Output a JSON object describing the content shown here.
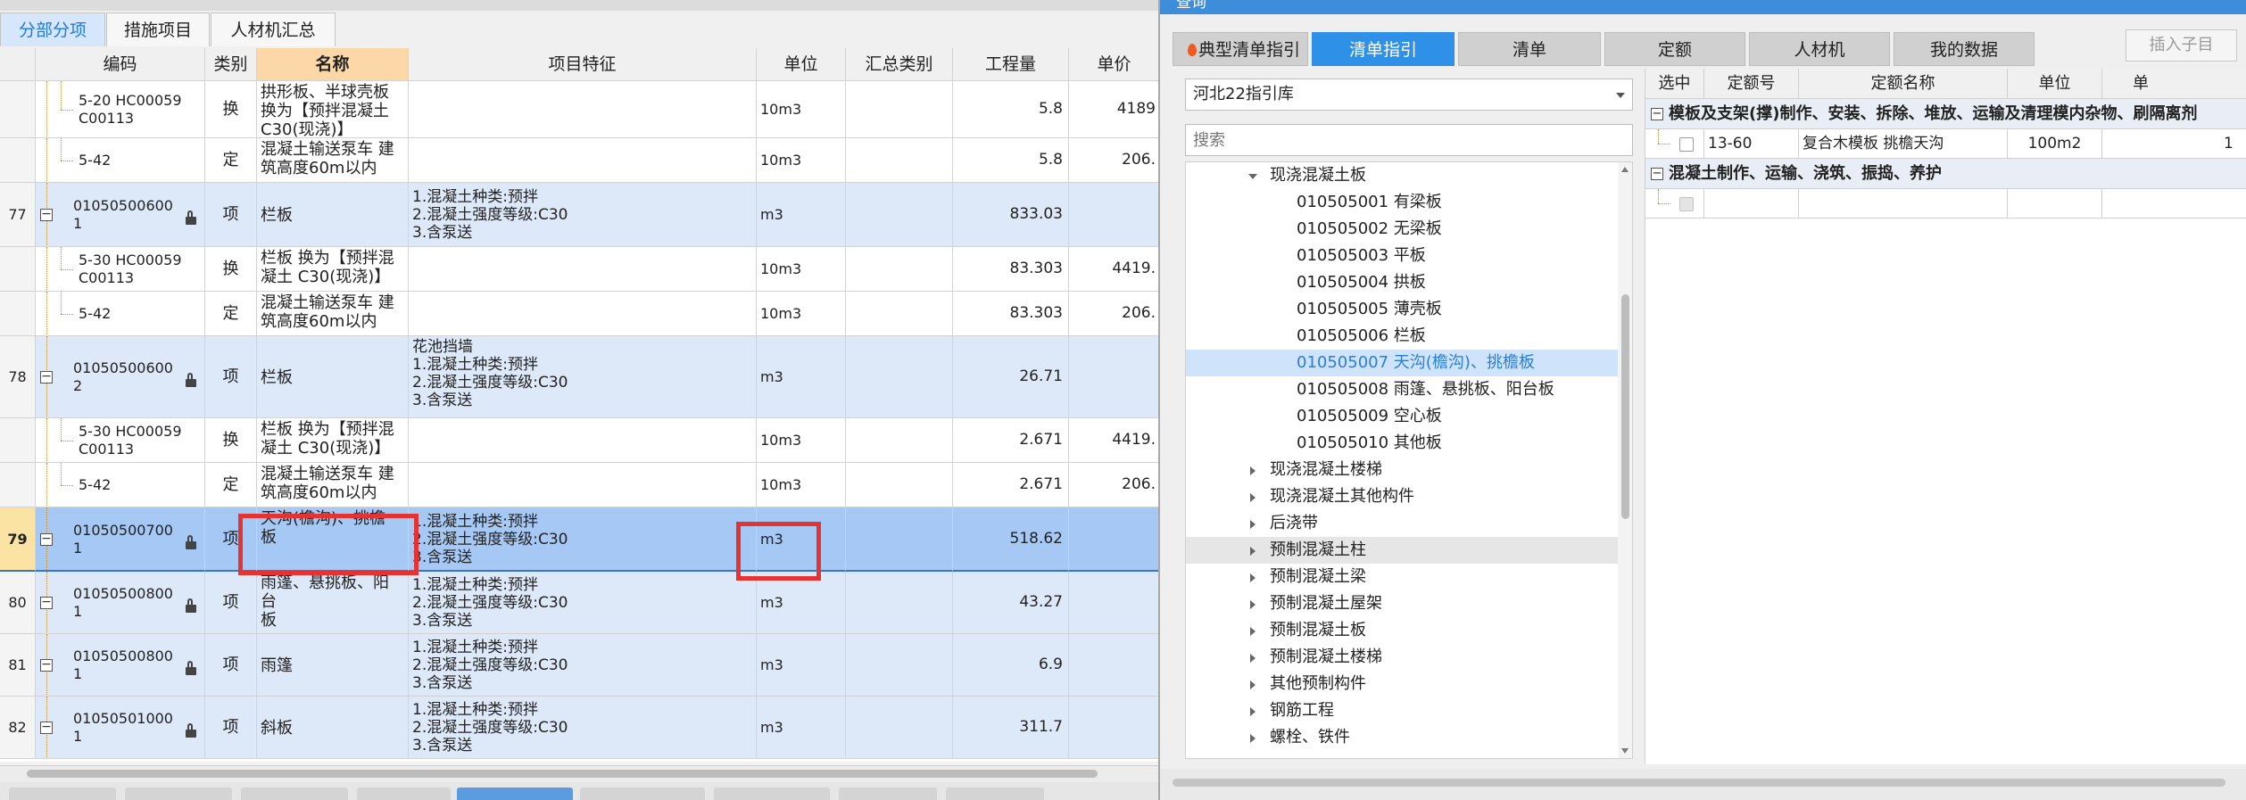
{
  "left_tabs": [
    "分部分项",
    "措施项目",
    "人材机汇总"
  ],
  "columns": {
    "code": "编码",
    "type": "类别",
    "name": "名称",
    "features": "项目特征",
    "unit": "单位",
    "summary_type": "汇总类别",
    "quantity": "工程量",
    "price": "单价"
  },
  "rows": [
    {
      "idx": "",
      "code1": "5-20 HC00059",
      "code2": "C00113",
      "type": "换",
      "name": [
        "拱形板、半球壳板",
        "换为【预拌混凝土",
        "C30(现浇)】"
      ],
      "features": [],
      "unit": "10m3",
      "qty": "5.8",
      "price": "4189"
    },
    {
      "idx": "",
      "code1": "5-42",
      "code2": "",
      "type": "定",
      "name": [
        "混凝土输送泵车 建",
        "筑高度60m以内"
      ],
      "features": [],
      "unit": "10m3",
      "qty": "5.8",
      "price": "206."
    },
    {
      "idx": "77",
      "code1": "01050500600",
      "code2": "1",
      "type": "项",
      "name": [
        "栏板"
      ],
      "features": [
        "1.混凝土种类:预拌",
        "2.混凝土强度等级:C30",
        "3.含泵送"
      ],
      "unit": "m3",
      "qty": "833.03",
      "price": ""
    },
    {
      "idx": "",
      "code1": "5-30 HC00059",
      "code2": "C00113",
      "type": "换",
      "name": [
        "栏板  换为【预拌混",
        "凝土 C30(现浇)】"
      ],
      "features": [],
      "unit": "10m3",
      "qty": "83.303",
      "price": "4419."
    },
    {
      "idx": "",
      "code1": "5-42",
      "code2": "",
      "type": "定",
      "name": [
        "混凝土输送泵车 建",
        "筑高度60m以内"
      ],
      "features": [],
      "unit": "10m3",
      "qty": "83.303",
      "price": "206."
    },
    {
      "idx": "78",
      "code1": "01050500600",
      "code2": "2",
      "type": "项",
      "name": [
        "栏板"
      ],
      "features": [
        "花池挡墙",
        "1.混凝土种类:预拌",
        "2.混凝土强度等级:C30",
        "3.含泵送"
      ],
      "unit": "m3",
      "qty": "26.71",
      "price": ""
    },
    {
      "idx": "",
      "code1": "5-30 HC00059",
      "code2": "C00113",
      "type": "换",
      "name": [
        "栏板  换为【预拌混",
        "凝土 C30(现浇)】"
      ],
      "features": [],
      "unit": "10m3",
      "qty": "2.671",
      "price": "4419."
    },
    {
      "idx": "",
      "code1": "5-42",
      "code2": "",
      "type": "定",
      "name": [
        "混凝土输送泵车 建",
        "筑高度60m以内"
      ],
      "features": [],
      "unit": "10m3",
      "qty": "2.671",
      "price": "206."
    },
    {
      "idx": "79",
      "code1": "01050500700",
      "code2": "1",
      "type": "项",
      "name": [
        "天沟(檐沟)、挑檐",
        "板"
      ],
      "features": [
        "1.混凝土种类:预拌",
        "2.混凝土强度等级:C30",
        "3.含泵送"
      ],
      "unit": "m3",
      "qty": "518.62",
      "price": ""
    },
    {
      "idx": "80",
      "code1": "01050500800",
      "code2": "1",
      "type": "项",
      "name": [
        "雨篷、悬挑板、阳台",
        "板"
      ],
      "features": [
        "1.混凝土种类:预拌",
        "2.混凝土强度等级:C30",
        "3.含泵送"
      ],
      "unit": "m3",
      "qty": "43.27",
      "price": ""
    },
    {
      "idx": "81",
      "code1": "01050500800",
      "code2": "1",
      "type": "项",
      "name": [
        "雨篷"
      ],
      "features": [
        "1.混凝土种类:预拌",
        "2.混凝土强度等级:C30",
        "3.含泵送"
      ],
      "unit": "m3",
      "qty": "6.9",
      "price": ""
    },
    {
      "idx": "82",
      "code1": "01050501000",
      "code2": "1",
      "type": "项",
      "name": [
        "斜板"
      ],
      "features": [
        "1.混凝土种类:预拌",
        "2.混凝土强度等级:C30",
        "3.含泵送"
      ],
      "unit": "m3",
      "qty": "311.7",
      "price": ""
    }
  ],
  "panel": {
    "title": "查询",
    "tabs": [
      "典型清单指引",
      "清单指引",
      "清单",
      "定额",
      "人材机",
      "我的数据"
    ],
    "insert_button": "插入子目",
    "library": "河北22指引库",
    "search_placeholder": "搜索",
    "tree": [
      {
        "label": "现浇混凝土板",
        "level": 1,
        "arrow": "down"
      },
      {
        "label": "010505001  有梁板",
        "level": 2
      },
      {
        "label": "010505002  无梁板",
        "level": 2
      },
      {
        "label": "010505003  平板",
        "level": 2
      },
      {
        "label": "010505004  拱板",
        "level": 2
      },
      {
        "label": "010505005  薄壳板",
        "level": 2
      },
      {
        "label": "010505006  栏板",
        "level": 2
      },
      {
        "label": "010505007  天沟(檐沟)、挑檐板",
        "level": 2,
        "selected": true
      },
      {
        "label": "010505008  雨篷、悬挑板、阳台板",
        "level": 2
      },
      {
        "label": "010505009  空心板",
        "level": 2
      },
      {
        "label": "010505010  其他板",
        "level": 2
      },
      {
        "label": "现浇混凝土楼梯",
        "level": 1,
        "arrow": "right"
      },
      {
        "label": "现浇混凝土其他构件",
        "level": 1,
        "arrow": "right"
      },
      {
        "label": "后浇带",
        "level": 1,
        "arrow": "right"
      },
      {
        "label": "预制混凝土柱",
        "level": 1,
        "arrow": "right",
        "hover": true
      },
      {
        "label": "预制混凝土梁",
        "level": 1,
        "arrow": "right"
      },
      {
        "label": "预制混凝土屋架",
        "level": 1,
        "arrow": "right"
      },
      {
        "label": "预制混凝土板",
        "level": 1,
        "arrow": "right"
      },
      {
        "label": "预制混凝土楼梯",
        "level": 1,
        "arrow": "right"
      },
      {
        "label": "其他预制构件",
        "level": 1,
        "arrow": "right"
      },
      {
        "label": "钢筋工程",
        "level": 1,
        "arrow": "right"
      },
      {
        "label": "螺栓、铁件",
        "level": 1,
        "arrow": "right"
      }
    ],
    "quota_columns": [
      "选中",
      "定额号",
      "定额名称",
      "单位",
      "单"
    ],
    "groups": [
      {
        "title": "模板及支架(撑)制作、安装、拆除、堆放、运输及清理模内杂物、刷隔离剂",
        "rows": [
          {
            "code": "13-60",
            "name": "复合木模板 挑檐天沟",
            "unit": "100m2",
            "extra": "1"
          }
        ]
      },
      {
        "title": "混凝土制作、运输、浇筑、振捣、养护",
        "rows": [
          {
            "code": "",
            "name": "",
            "unit": "",
            "extra": ""
          }
        ]
      }
    ]
  }
}
